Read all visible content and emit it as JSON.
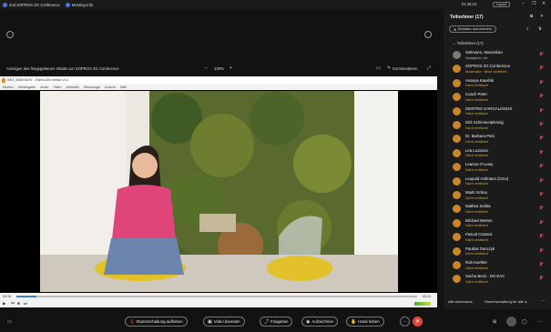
{
  "topbar": {
    "tab1": "2nd SOPROS ZG Conference",
    "tab2": "Meeting-Info",
    "clock": "01:26:24",
    "layout_label": "Layout",
    "minimize": "–",
    "restore": "❐",
    "close": "✕"
  },
  "share": {
    "label": "Anzeigen des freigegebenen Inhalts von SOPROS ZG Conference",
    "zoom_minus": "−",
    "zoom": "100%",
    "zoom_plus": "+",
    "comments_label": "Kommentieren"
  },
  "vlc": {
    "title": "IMG_3585.MOV - VideoLAN media VLC",
    "menu": [
      "Medien",
      "Wiedergabe",
      "Audio",
      "Video",
      "Untertitel",
      "Werkzeuge",
      "Ansicht",
      "Hilfe"
    ],
    "elapsed": "00:16",
    "remaining": "-05:43",
    "progress": 0.05
  },
  "panel": {
    "title": "Teilnehmer (17)",
    "invite_label": "Einladen und erinnern",
    "group_label": "Teilnehmer (17)",
    "participants": [
      {
        "name": "Seltmann, Maximilian",
        "status": "Gastgeber, ich",
        "photo": true
      },
      {
        "name": "SOPROS ZG Conference",
        "status": "Moderator ·  Nicht verifiziert",
        "photo": false
      },
      {
        "name": "Ananya Kaushik",
        "status": "Nicht verifiziert",
        "photo": false
      },
      {
        "name": "Coach Peter",
        "status": "Nicht verifiziert",
        "photo": false
      },
      {
        "name": "DIMITRIS GARGALIANOS",
        "status": "Nicht verifiziert",
        "photo": false
      },
      {
        "name": "Dirk Schimmelpfennig",
        "status": "Nicht verifiziert",
        "photo": false
      },
      {
        "name": "Dr. Barbara Petri",
        "status": "Nicht verifiziert",
        "photo": false
      },
      {
        "name": "Lea Lozancic",
        "status": "Nicht verifiziert",
        "photo": false
      },
      {
        "name": "Leanne O'Leary",
        "status": "Nicht verifiziert",
        "photo": false
      },
      {
        "name": "Leopold Hofmann (GSU)",
        "status": "Nicht verifiziert",
        "photo": false
      },
      {
        "name": "Mads Schou",
        "status": "Nicht verifiziert",
        "photo": false
      },
      {
        "name": "Mathea Saliba",
        "status": "Nicht verifiziert",
        "photo": false
      },
      {
        "name": "Michael Merten",
        "status": "Nicht verifiziert",
        "photo": false
      },
      {
        "name": "Pascal Camara",
        "status": "Nicht verifiziert",
        "photo": false
      },
      {
        "name": "Paulina Tomczyk",
        "status": "Nicht verifiziert",
        "photo": false
      },
      {
        "name": "Rob Koehler",
        "status": "Nicht verifiziert",
        "photo": false
      },
      {
        "name": "Sacha Beck - DG EAC",
        "status": "Nicht verifiziert",
        "photo": false
      }
    ],
    "mute_all": "Alle stummsch...",
    "mute_all_on_join": "Stummschaltung für alle a..."
  },
  "toolbar": {
    "mute_label": "Stummschaltung aufheben",
    "video_label": "Video beenden",
    "share_label": "Freigeben",
    "record_label": "Aufzeichnen",
    "raise_label": "Hand heben",
    "more": "···"
  },
  "colors": {
    "accent": "#e0a23a",
    "end_call": "#e0463c",
    "panel_bg": "#1b1b1b"
  }
}
